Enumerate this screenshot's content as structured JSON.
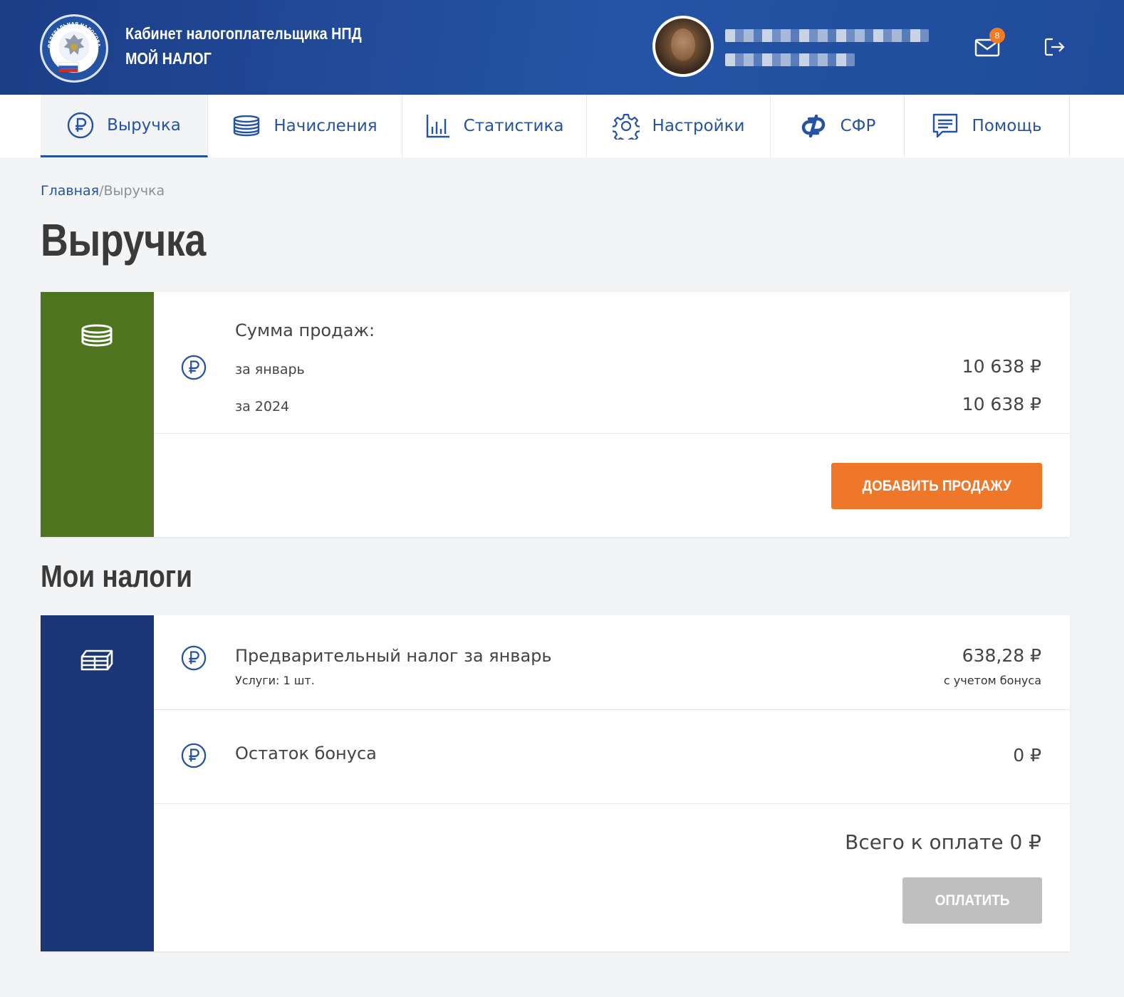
{
  "header": {
    "title_line1": "Кабинет налогоплательщика НПД",
    "title_line2": "МОЙ НАЛОГ",
    "logo_text": "ФЕДЕРАЛЬНАЯ НАЛОГОВАЯ СЛУЖБА",
    "notifications_count": "8"
  },
  "nav": {
    "tabs": [
      {
        "label": "Выручка",
        "icon": "ruble-circle-icon",
        "active": true
      },
      {
        "label": "Начисления",
        "icon": "coins-stack-icon"
      },
      {
        "label": "Статистика",
        "icon": "bar-chart-icon"
      },
      {
        "label": "Настройки",
        "icon": "gear-icon"
      },
      {
        "label": "СФР",
        "icon": "sfr-logo-icon"
      },
      {
        "label": "Помощь",
        "icon": "chat-icon"
      }
    ]
  },
  "breadcrumb": {
    "home": "Главная",
    "separator": "/",
    "current": "Выручка"
  },
  "page_title": "Выручка",
  "sales": {
    "heading": "Сумма продаж:",
    "rows": [
      {
        "label": "за январь",
        "value": "10 638 ₽"
      },
      {
        "label": "за 2024",
        "value": "10 638 ₽"
      }
    ],
    "add_button": "ДОБАВИТЬ ПРОДАЖУ"
  },
  "taxes": {
    "heading": "Мои налоги",
    "preliminary": {
      "label": "Предварительный налог за январь",
      "sub": "Услуги: 1 шт.",
      "value": "638,28 ₽",
      "value_note": "с учетом бонуса"
    },
    "bonus": {
      "label": "Остаток бонуса",
      "value": "0 ₽"
    },
    "total": "Всего к оплате 0 ₽",
    "pay_button": "ОПЛАТИТЬ"
  },
  "colors": {
    "primary": "#2553a3",
    "header_bg": "#1f4b99",
    "sales_side": "#4e7420",
    "tax_side": "#1a3677",
    "accent": "#ef7729",
    "disabled": "#bfbfbf"
  }
}
